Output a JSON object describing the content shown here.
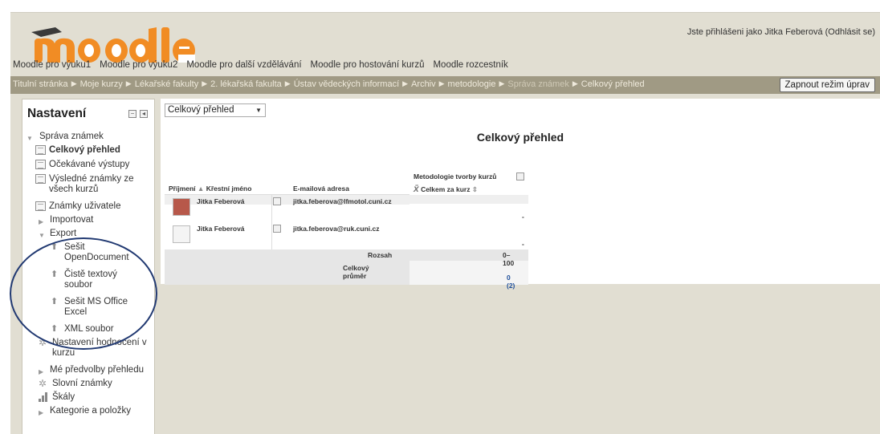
{
  "header": {
    "logo_text": "moodle",
    "login_info": "Jste přihlášeni jako Jitka Feberová (Odhlásit se)"
  },
  "custommenu": [
    "Moodle pro výuku1",
    "Moodle pro výuku2",
    "Moodle pro další vzdělávání",
    "Moodle pro hostování kurzů",
    "Moodle rozcestník"
  ],
  "breadcrumb": [
    "Titulní stránka",
    "Moje kurzy",
    "Lékařské fakulty",
    "2. lékařská fakulta",
    "Ústav vědeckých informací",
    "Archiv",
    "metodologie",
    "Správa známek",
    "Celkový přehled"
  ],
  "edit_button": "Zapnout režim úprav",
  "block": {
    "title": "Nastavení",
    "items": {
      "sprava": "Správa známek",
      "celkovy": "Celkový přehled",
      "ocekavane": "Očekávané výstupy",
      "vysledne_1": "Výsledné známky ze",
      "vysledne_2": "všech kurzů",
      "uzivatele": "Známky uživatele",
      "importovat": "Importovat",
      "export": "Export",
      "ods_1": "Sešit",
      "ods_2": "OpenDocument",
      "txt_1": "Čistě textový",
      "txt_2": "soubor",
      "xls_1": "Sešit MS Office",
      "xls_2": "Excel",
      "xml": "XML soubor",
      "nastaveni_1": "Nastavení hodnocení v",
      "nastaveni_2": "kurzu",
      "predvolby": "Mé předvolby přehledu",
      "slovni": "Slovní známky",
      "skaly": "Škály",
      "kategorie": "Kategorie a položky"
    }
  },
  "main": {
    "select_value": "Celkový přehled",
    "title": "Celkový přehled",
    "table": {
      "col_prijmeni": "Příjmení",
      "col_krestni": "Křestní jméno",
      "col_email": "E-mailová adresa",
      "col_course": "Metodologie tvorby kurzů",
      "col_total": "Celkem za kurz",
      "rows": [
        {
          "name": "Jitka Feberová",
          "email": "jitka.feberova@lfmotol.cuni.cz",
          "total": "-"
        },
        {
          "name": "Jitka Feberová",
          "email": "jitka.feberova@ruk.cuni.cz",
          "total": "-"
        }
      ],
      "range_label": "Rozsah",
      "range_value": "0–100",
      "avg_label": "Celkový průměr",
      "avg_value": "0 (2)"
    }
  },
  "colors": {
    "page_bg": "#e1ded2",
    "navbar_bg": "#a09a84",
    "annotation_circle": "#223a72"
  }
}
